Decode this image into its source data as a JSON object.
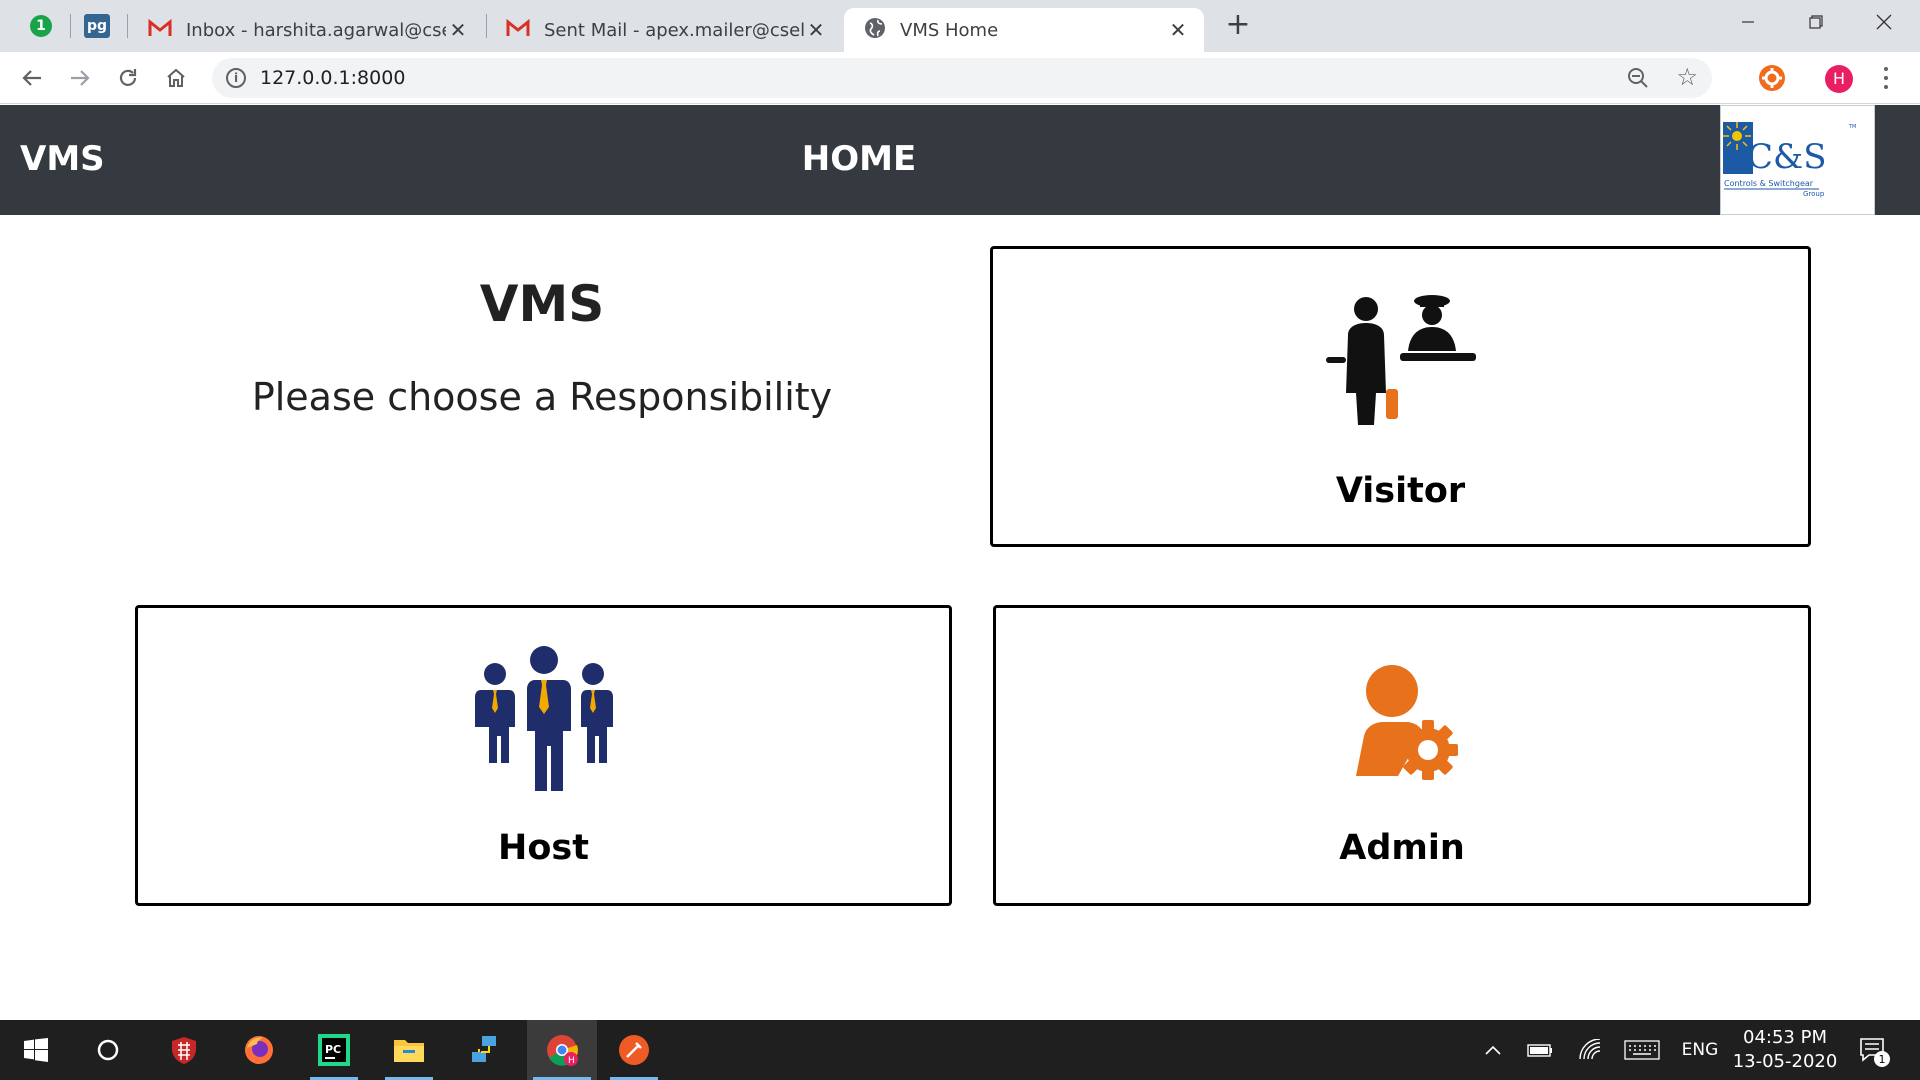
{
  "browser": {
    "tabs": [
      {
        "title": "Inbox - harshita.agarwal@cselectric",
        "close": "✕"
      },
      {
        "title": "Sent Mail - apex.mailer@cselectric",
        "close": "✕"
      },
      {
        "title": "VMS Home",
        "close": "✕"
      }
    ],
    "pinned_badge": "1",
    "pinned_pg": "pg",
    "new_tab": "+",
    "url": "127.0.0.1:8000",
    "profile_initial": "H"
  },
  "app": {
    "brand": "VMS",
    "nav_title": "HOME",
    "logo": {
      "text": "C&S",
      "tagline": "Controls & Switchgear",
      "group": "Group",
      "tm": "TM"
    },
    "intro": {
      "title": "VMS",
      "subtitle": "Please choose a Responsibility"
    },
    "cards": {
      "visitor": {
        "label": "Visitor"
      },
      "host": {
        "label": "Host"
      },
      "admin": {
        "label": "Admin"
      }
    },
    "colors": {
      "navbar": "#343a40",
      "host_icon": "#1f2d6b",
      "accent_orange": "#e8711c"
    }
  },
  "taskbar": {
    "language": "ENG",
    "time": "04:53 PM",
    "date": "13-05-2020",
    "notification_count": "1",
    "pycharm": "PC"
  }
}
